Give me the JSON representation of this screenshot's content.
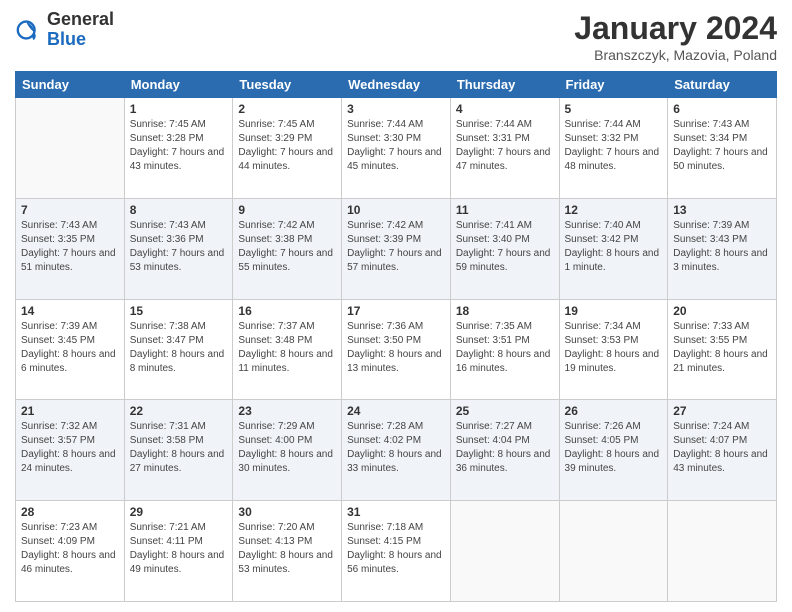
{
  "header": {
    "logo_general": "General",
    "logo_blue": "Blue",
    "month_title": "January 2024",
    "location": "Branszczyk, Mazovia, Poland"
  },
  "weekdays": [
    "Sunday",
    "Monday",
    "Tuesday",
    "Wednesday",
    "Thursday",
    "Friday",
    "Saturday"
  ],
  "weeks": [
    [
      {
        "day": "",
        "sunrise": "",
        "sunset": "",
        "daylight": ""
      },
      {
        "day": "1",
        "sunrise": "Sunrise: 7:45 AM",
        "sunset": "Sunset: 3:28 PM",
        "daylight": "Daylight: 7 hours and 43 minutes."
      },
      {
        "day": "2",
        "sunrise": "Sunrise: 7:45 AM",
        "sunset": "Sunset: 3:29 PM",
        "daylight": "Daylight: 7 hours and 44 minutes."
      },
      {
        "day": "3",
        "sunrise": "Sunrise: 7:44 AM",
        "sunset": "Sunset: 3:30 PM",
        "daylight": "Daylight: 7 hours and 45 minutes."
      },
      {
        "day": "4",
        "sunrise": "Sunrise: 7:44 AM",
        "sunset": "Sunset: 3:31 PM",
        "daylight": "Daylight: 7 hours and 47 minutes."
      },
      {
        "day": "5",
        "sunrise": "Sunrise: 7:44 AM",
        "sunset": "Sunset: 3:32 PM",
        "daylight": "Daylight: 7 hours and 48 minutes."
      },
      {
        "day": "6",
        "sunrise": "Sunrise: 7:43 AM",
        "sunset": "Sunset: 3:34 PM",
        "daylight": "Daylight: 7 hours and 50 minutes."
      }
    ],
    [
      {
        "day": "7",
        "sunrise": "Sunrise: 7:43 AM",
        "sunset": "Sunset: 3:35 PM",
        "daylight": "Daylight: 7 hours and 51 minutes."
      },
      {
        "day": "8",
        "sunrise": "Sunrise: 7:43 AM",
        "sunset": "Sunset: 3:36 PM",
        "daylight": "Daylight: 7 hours and 53 minutes."
      },
      {
        "day": "9",
        "sunrise": "Sunrise: 7:42 AM",
        "sunset": "Sunset: 3:38 PM",
        "daylight": "Daylight: 7 hours and 55 minutes."
      },
      {
        "day": "10",
        "sunrise": "Sunrise: 7:42 AM",
        "sunset": "Sunset: 3:39 PM",
        "daylight": "Daylight: 7 hours and 57 minutes."
      },
      {
        "day": "11",
        "sunrise": "Sunrise: 7:41 AM",
        "sunset": "Sunset: 3:40 PM",
        "daylight": "Daylight: 7 hours and 59 minutes."
      },
      {
        "day": "12",
        "sunrise": "Sunrise: 7:40 AM",
        "sunset": "Sunset: 3:42 PM",
        "daylight": "Daylight: 8 hours and 1 minute."
      },
      {
        "day": "13",
        "sunrise": "Sunrise: 7:39 AM",
        "sunset": "Sunset: 3:43 PM",
        "daylight": "Daylight: 8 hours and 3 minutes."
      }
    ],
    [
      {
        "day": "14",
        "sunrise": "Sunrise: 7:39 AM",
        "sunset": "Sunset: 3:45 PM",
        "daylight": "Daylight: 8 hours and 6 minutes."
      },
      {
        "day": "15",
        "sunrise": "Sunrise: 7:38 AM",
        "sunset": "Sunset: 3:47 PM",
        "daylight": "Daylight: 8 hours and 8 minutes."
      },
      {
        "day": "16",
        "sunrise": "Sunrise: 7:37 AM",
        "sunset": "Sunset: 3:48 PM",
        "daylight": "Daylight: 8 hours and 11 minutes."
      },
      {
        "day": "17",
        "sunrise": "Sunrise: 7:36 AM",
        "sunset": "Sunset: 3:50 PM",
        "daylight": "Daylight: 8 hours and 13 minutes."
      },
      {
        "day": "18",
        "sunrise": "Sunrise: 7:35 AM",
        "sunset": "Sunset: 3:51 PM",
        "daylight": "Daylight: 8 hours and 16 minutes."
      },
      {
        "day": "19",
        "sunrise": "Sunrise: 7:34 AM",
        "sunset": "Sunset: 3:53 PM",
        "daylight": "Daylight: 8 hours and 19 minutes."
      },
      {
        "day": "20",
        "sunrise": "Sunrise: 7:33 AM",
        "sunset": "Sunset: 3:55 PM",
        "daylight": "Daylight: 8 hours and 21 minutes."
      }
    ],
    [
      {
        "day": "21",
        "sunrise": "Sunrise: 7:32 AM",
        "sunset": "Sunset: 3:57 PM",
        "daylight": "Daylight: 8 hours and 24 minutes."
      },
      {
        "day": "22",
        "sunrise": "Sunrise: 7:31 AM",
        "sunset": "Sunset: 3:58 PM",
        "daylight": "Daylight: 8 hours and 27 minutes."
      },
      {
        "day": "23",
        "sunrise": "Sunrise: 7:29 AM",
        "sunset": "Sunset: 4:00 PM",
        "daylight": "Daylight: 8 hours and 30 minutes."
      },
      {
        "day": "24",
        "sunrise": "Sunrise: 7:28 AM",
        "sunset": "Sunset: 4:02 PM",
        "daylight": "Daylight: 8 hours and 33 minutes."
      },
      {
        "day": "25",
        "sunrise": "Sunrise: 7:27 AM",
        "sunset": "Sunset: 4:04 PM",
        "daylight": "Daylight: 8 hours and 36 minutes."
      },
      {
        "day": "26",
        "sunrise": "Sunrise: 7:26 AM",
        "sunset": "Sunset: 4:05 PM",
        "daylight": "Daylight: 8 hours and 39 minutes."
      },
      {
        "day": "27",
        "sunrise": "Sunrise: 7:24 AM",
        "sunset": "Sunset: 4:07 PM",
        "daylight": "Daylight: 8 hours and 43 minutes."
      }
    ],
    [
      {
        "day": "28",
        "sunrise": "Sunrise: 7:23 AM",
        "sunset": "Sunset: 4:09 PM",
        "daylight": "Daylight: 8 hours and 46 minutes."
      },
      {
        "day": "29",
        "sunrise": "Sunrise: 7:21 AM",
        "sunset": "Sunset: 4:11 PM",
        "daylight": "Daylight: 8 hours and 49 minutes."
      },
      {
        "day": "30",
        "sunrise": "Sunrise: 7:20 AM",
        "sunset": "Sunset: 4:13 PM",
        "daylight": "Daylight: 8 hours and 53 minutes."
      },
      {
        "day": "31",
        "sunrise": "Sunrise: 7:18 AM",
        "sunset": "Sunset: 4:15 PM",
        "daylight": "Daylight: 8 hours and 56 minutes."
      },
      {
        "day": "",
        "sunrise": "",
        "sunset": "",
        "daylight": ""
      },
      {
        "day": "",
        "sunrise": "",
        "sunset": "",
        "daylight": ""
      },
      {
        "day": "",
        "sunrise": "",
        "sunset": "",
        "daylight": ""
      }
    ]
  ]
}
